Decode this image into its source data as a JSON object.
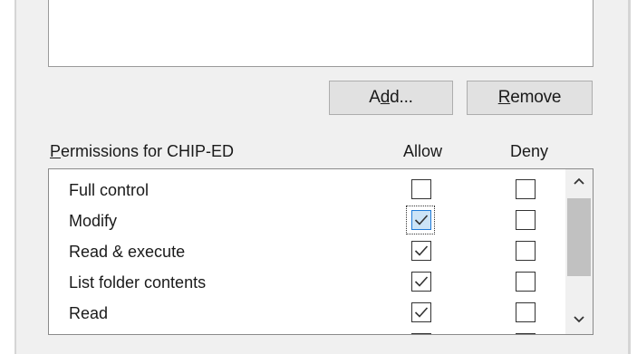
{
  "buttons": {
    "add": {
      "pre": "A",
      "accel": "d",
      "post": "d..."
    },
    "remove": {
      "pre": "",
      "accel": "R",
      "post": "emove"
    }
  },
  "permissions": {
    "title_accel": "P",
    "title_rest": "ermissions for CHIP-ED",
    "allow_header": "Allow",
    "deny_header": "Deny",
    "rows": [
      {
        "label": "Full control",
        "allow": false,
        "deny": false
      },
      {
        "label": "Modify",
        "allow": true,
        "deny": false,
        "focused": true
      },
      {
        "label": "Read & execute",
        "allow": true,
        "deny": false
      },
      {
        "label": "List folder contents",
        "allow": true,
        "deny": false
      },
      {
        "label": "Read",
        "allow": true,
        "deny": false
      }
    ]
  },
  "scrollbar": {
    "up_icon": "chevron-up-icon",
    "down_icon": "chevron-down-icon"
  }
}
